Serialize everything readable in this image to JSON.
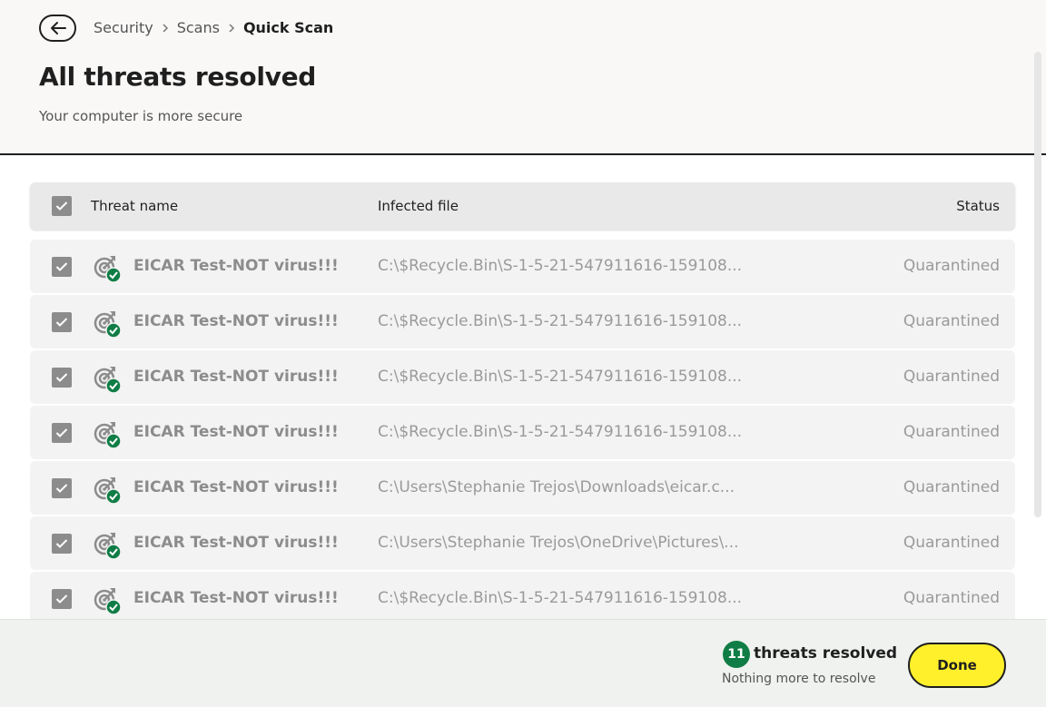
{
  "breadcrumb": {
    "items": [
      "Security",
      "Scans"
    ],
    "current": "Quick Scan"
  },
  "header": {
    "title": "All threats resolved",
    "subtitle": "Your computer is more secure"
  },
  "table": {
    "columns": {
      "name": "Threat name",
      "file": "Infected file",
      "status": "Status"
    },
    "rows": [
      {
        "name": "EICAR Test-NOT virus!!!",
        "file": "C:\\$Recycle.Bin\\S-1-5-21-547911616-159108...",
        "status": "Quarantined"
      },
      {
        "name": "EICAR Test-NOT virus!!!",
        "file": "C:\\$Recycle.Bin\\S-1-5-21-547911616-159108...",
        "status": "Quarantined"
      },
      {
        "name": "EICAR Test-NOT virus!!!",
        "file": "C:\\$Recycle.Bin\\S-1-5-21-547911616-159108...",
        "status": "Quarantined"
      },
      {
        "name": "EICAR Test-NOT virus!!!",
        "file": "C:\\$Recycle.Bin\\S-1-5-21-547911616-159108...",
        "status": "Quarantined"
      },
      {
        "name": "EICAR Test-NOT virus!!!",
        "file": "C:\\Users\\Stephanie Trejos\\Downloads\\eicar.c...",
        "status": "Quarantined"
      },
      {
        "name": "EICAR Test-NOT virus!!!",
        "file": "C:\\Users\\Stephanie Trejos\\OneDrive\\Pictures\\...",
        "status": "Quarantined"
      },
      {
        "name": "EICAR Test-NOT virus!!!",
        "file": "C:\\$Recycle.Bin\\S-1-5-21-547911616-159108...",
        "status": "Quarantined"
      }
    ]
  },
  "footer": {
    "count": "11",
    "resolved_label": "threats resolved",
    "resolved_sub": "Nothing more to resolve",
    "done_label": "Done"
  },
  "colors": {
    "accent_green": "#0f7d45",
    "done_yellow": "#fff02b",
    "checkbox_gray": "#8c8c8c"
  },
  "icons": {
    "back": "arrow-left-icon",
    "breadcrumb_sep": "chevron-right-icon",
    "checkbox": "checkmark-icon",
    "threat": "target-arrow-icon",
    "resolved": "check-circle-icon"
  }
}
